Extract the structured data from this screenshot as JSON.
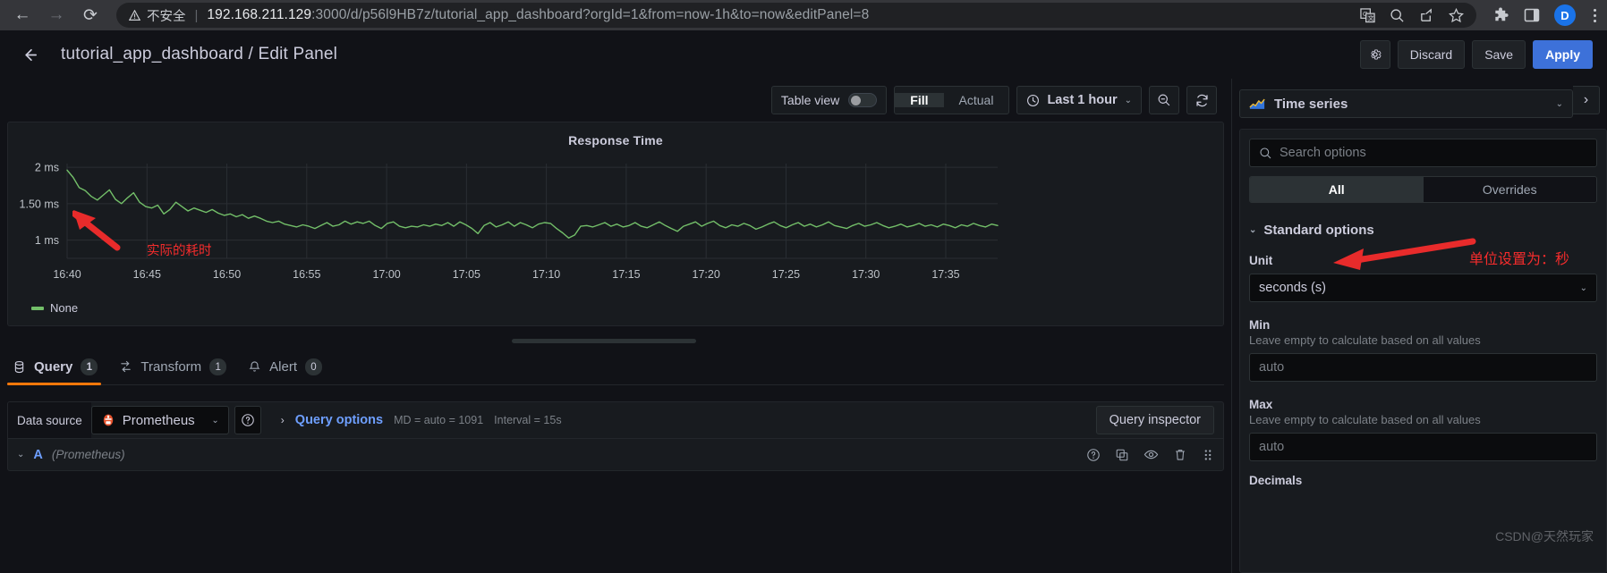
{
  "browser": {
    "back_icon": "back-arrow-icon",
    "forward_icon": "forward-arrow-icon",
    "reload_icon": "reload-icon",
    "security_label": "不安全",
    "url_host": "192.168.211.129",
    "url_rest": ":3000/d/p56l9HB7z/tutorial_app_dashboard?orgId=1&from=now-1h&to=now&editPanel=8",
    "icons": [
      "translate-icon",
      "search-icon",
      "share-icon",
      "star-icon",
      "extensions-icon",
      "sidepanel-icon"
    ],
    "profile_initial": "D",
    "menu_icon": "kebab-menu-icon"
  },
  "header": {
    "back_label": "←",
    "breadcrumb": "tutorial_app_dashboard / Edit Panel",
    "settings_icon": "gear-icon",
    "discard_label": "Discard",
    "save_label": "Save",
    "apply_label": "Apply"
  },
  "viz_toolbar": {
    "table_view_label": "Table view",
    "table_view_on": false,
    "fill_label": "Fill",
    "actual_label": "Actual",
    "active_fit": "Fill",
    "time_range": "Last 1 hour",
    "clock_icon": "clock-icon",
    "zoom_out_icon": "zoom-out-icon",
    "refresh_icon": "refresh-icon"
  },
  "panel": {
    "title": "Response Time",
    "legend_label": "None",
    "legend_color": "#73bf69",
    "annotation": "实际的耗时"
  },
  "chart_data": {
    "type": "line",
    "title": "Response Time",
    "xlabel": "",
    "ylabel": "",
    "ylim": [
      0.75,
      2.05
    ],
    "ytick_labels": [
      "1 ms",
      "1.50 ms",
      "2 ms"
    ],
    "ytick_values": [
      1,
      1.5,
      2
    ],
    "xtick_labels": [
      "16:40",
      "16:45",
      "16:50",
      "16:55",
      "17:00",
      "17:05",
      "17:10",
      "17:15",
      "17:20",
      "17:25",
      "17:30",
      "17:35"
    ],
    "grid": true,
    "legend_position": "bottom-left",
    "series": [
      {
        "name": "None",
        "color": "#73bf69",
        "values": [
          1.96,
          1.86,
          1.72,
          1.68,
          1.6,
          1.55,
          1.62,
          1.69,
          1.56,
          1.5,
          1.58,
          1.65,
          1.52,
          1.46,
          1.44,
          1.48,
          1.36,
          1.42,
          1.52,
          1.46,
          1.4,
          1.44,
          1.41,
          1.38,
          1.42,
          1.37,
          1.34,
          1.36,
          1.32,
          1.35,
          1.3,
          1.33,
          1.3,
          1.26,
          1.24,
          1.26,
          1.22,
          1.2,
          1.18,
          1.21,
          1.19,
          1.16,
          1.2,
          1.24,
          1.19,
          1.21,
          1.26,
          1.22,
          1.25,
          1.23,
          1.26,
          1.2,
          1.16,
          1.23,
          1.25,
          1.19,
          1.17,
          1.19,
          1.18,
          1.21,
          1.19,
          1.22,
          1.2,
          1.24,
          1.19,
          1.25,
          1.21,
          1.16,
          1.09,
          1.2,
          1.24,
          1.18,
          1.21,
          1.25,
          1.19,
          1.24,
          1.21,
          1.17,
          1.22,
          1.24,
          1.23,
          1.16,
          1.1,
          1.03,
          1.07,
          1.19,
          1.2,
          1.18,
          1.21,
          1.24,
          1.19,
          1.22,
          1.18,
          1.2,
          1.24,
          1.19,
          1.17,
          1.21,
          1.25,
          1.2,
          1.16,
          1.12,
          1.19,
          1.22,
          1.25,
          1.19,
          1.23,
          1.26,
          1.2,
          1.17,
          1.21,
          1.19,
          1.23,
          1.2,
          1.15,
          1.18,
          1.22,
          1.25,
          1.2,
          1.17,
          1.21,
          1.24,
          1.19,
          1.22,
          1.18,
          1.21,
          1.25,
          1.2,
          1.18,
          1.16,
          1.2,
          1.23,
          1.19,
          1.21,
          1.24,
          1.2,
          1.17,
          1.19,
          1.22,
          1.18,
          1.2,
          1.23,
          1.19,
          1.21,
          1.18,
          1.22,
          1.2,
          1.17,
          1.21,
          1.19,
          1.23,
          1.2,
          1.18,
          1.22,
          1.2
        ]
      }
    ]
  },
  "tabs": [
    {
      "label": "Query",
      "count": "1",
      "icon": "database-icon",
      "active": true
    },
    {
      "label": "Transform",
      "count": "1",
      "icon": "transform-icon",
      "active": false
    },
    {
      "label": "Alert",
      "count": "0",
      "icon": "bell-icon",
      "active": false
    }
  ],
  "query": {
    "data_source_label": "Data source",
    "data_source_value": "Prometheus",
    "help_icon": "help-circle-icon",
    "query_options_label": "Query options",
    "max_data_points": "MD = auto = 1091",
    "interval": "Interval = 15s",
    "inspector_label": "Query inspector",
    "ref_id": "A",
    "ref_source": "(Prometheus)",
    "row_icons": [
      "help-circle-icon",
      "duplicate-icon",
      "eye-icon",
      "trash-icon",
      "drag-handle-icon"
    ]
  },
  "options": {
    "viz_type": "Time series",
    "viz_icon": "timeseries-icon",
    "search_placeholder": "Search options",
    "tab_all": "All",
    "tab_overrides": "Overrides",
    "active_tab": "All",
    "section_title": "Standard options",
    "unit_label": "Unit",
    "unit_value": "seconds (s)",
    "unit_annotation": "单位设置为：秒",
    "min_label": "Min",
    "min_desc": "Leave empty to calculate based on all values",
    "min_value": "auto",
    "max_label": "Max",
    "max_desc": "Leave empty to calculate based on all values",
    "max_value": "auto",
    "decimals_label": "Decimals",
    "watermark": "CSDN@天然玩家"
  },
  "colors": {
    "accent": "#3d71d9",
    "series": "#73bf69",
    "tab_underline": "#ff780a",
    "annotation": "#f52c2c",
    "link": "#6e9fff"
  }
}
